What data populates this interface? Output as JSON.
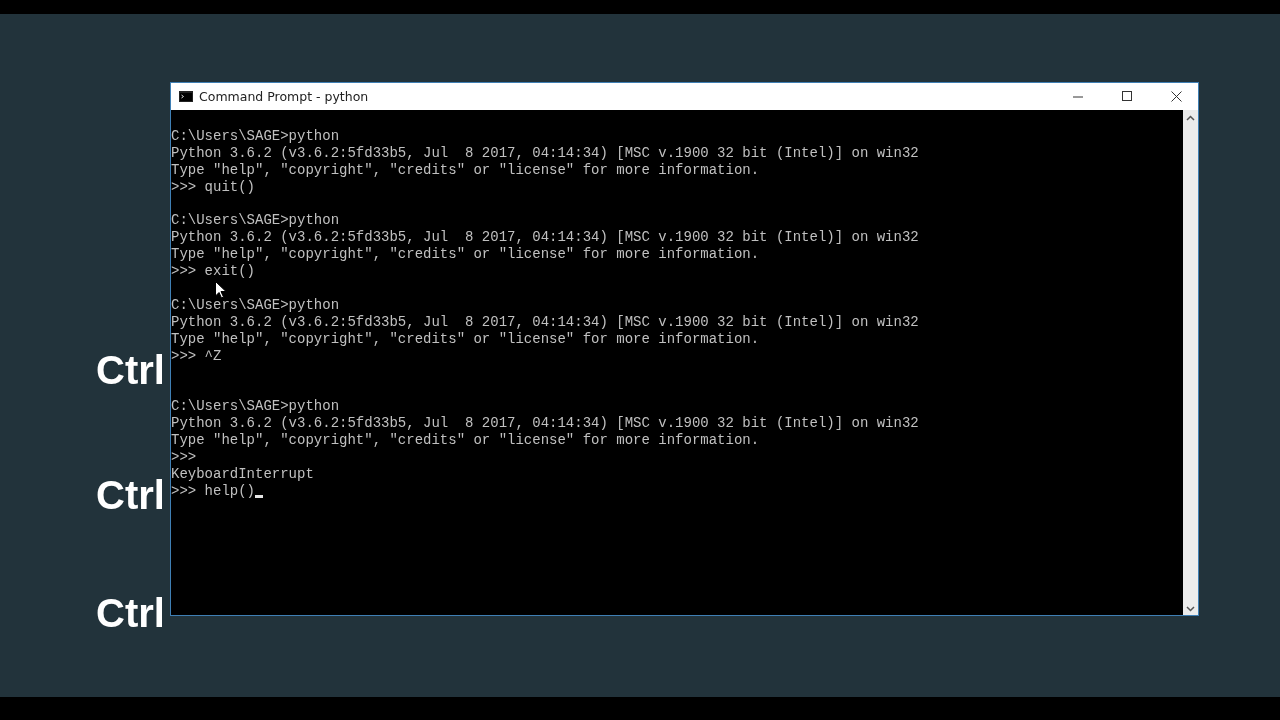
{
  "slide_labels": [
    "Ctrl",
    "Ctrl",
    "Ctrl"
  ],
  "window": {
    "title": "Command Prompt - python"
  },
  "console": {
    "lines": [
      {
        "kind": "text",
        "text": "C:\\Users\\SAGE>python"
      },
      {
        "kind": "text",
        "text": "Python 3.6.2 (v3.6.2:5fd33b5, Jul  8 2017, 04:14:34) [MSC v.1900 32 bit (Intel)] on win32"
      },
      {
        "kind": "text",
        "text": "Type \"help\", \"copyright\", \"credits\" or \"license\" for more information."
      },
      {
        "kind": "text",
        "text": ">>> quit()"
      },
      {
        "kind": "blank"
      },
      {
        "kind": "text",
        "text": "C:\\Users\\SAGE>python"
      },
      {
        "kind": "text",
        "text": "Python 3.6.2 (v3.6.2:5fd33b5, Jul  8 2017, 04:14:34) [MSC v.1900 32 bit (Intel)] on win32"
      },
      {
        "kind": "text",
        "text": "Type \"help\", \"copyright\", \"credits\" or \"license\" for more information."
      },
      {
        "kind": "text",
        "text": ">>> exit()"
      },
      {
        "kind": "blank"
      },
      {
        "kind": "text",
        "text": "C:\\Users\\SAGE>python"
      },
      {
        "kind": "text",
        "text": "Python 3.6.2 (v3.6.2:5fd33b5, Jul  8 2017, 04:14:34) [MSC v.1900 32 bit (Intel)] on win32"
      },
      {
        "kind": "text",
        "text": "Type \"help\", \"copyright\", \"credits\" or \"license\" for more information."
      },
      {
        "kind": "text",
        "text": ">>> ^Z"
      },
      {
        "kind": "blank"
      },
      {
        "kind": "blank"
      },
      {
        "kind": "text",
        "text": "C:\\Users\\SAGE>python"
      },
      {
        "kind": "text",
        "text": "Python 3.6.2 (v3.6.2:5fd33b5, Jul  8 2017, 04:14:34) [MSC v.1900 32 bit (Intel)] on win32"
      },
      {
        "kind": "text",
        "text": "Type \"help\", \"copyright\", \"credits\" or \"license\" for more information."
      },
      {
        "kind": "text",
        "text": ">>>"
      },
      {
        "kind": "text",
        "text": "KeyboardInterrupt"
      },
      {
        "kind": "text",
        "text": ">>> help()",
        "cursor": true
      }
    ]
  }
}
